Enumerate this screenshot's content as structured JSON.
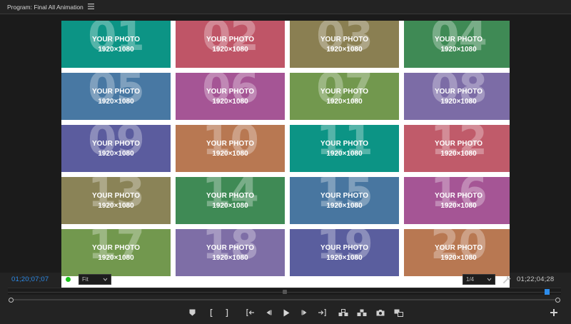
{
  "panel": {
    "title": "Program: Final All Animation",
    "menu_icon": "hamburger-icon"
  },
  "tiles": [
    {
      "num": "01",
      "label": "YOUR PHOTO",
      "res": "1920×1080",
      "color": "#0c9485"
    },
    {
      "num": "02",
      "label": "YOUR PHOTO",
      "res": "1920×1080",
      "color": "#bf5567"
    },
    {
      "num": "03",
      "label": "YOUR PHOTO",
      "res": "1920×1080",
      "color": "#8a7f52"
    },
    {
      "num": "04",
      "label": "YOUR PHOTO",
      "res": "1920×1080",
      "color": "#3f8a55"
    },
    {
      "num": "05",
      "label": "YOUR PHOTO",
      "res": "1920×1080",
      "color": "#4878a3"
    },
    {
      "num": "06",
      "label": "YOUR PHOTO",
      "res": "1920×1080",
      "color": "#a55595"
    },
    {
      "num": "07",
      "label": "YOUR PHOTO",
      "res": "1920×1080",
      "color": "#72984e"
    },
    {
      "num": "08",
      "label": "YOUR PHOTO",
      "res": "1920×1080",
      "color": "#7c6ca6"
    },
    {
      "num": "09",
      "label": "YOUR PHOTO",
      "res": "1920×1080",
      "color": "#5b5c9e"
    },
    {
      "num": "10",
      "label": "YOUR PHOTO",
      "res": "1920×1080",
      "color": "#b87852"
    },
    {
      "num": "11",
      "label": "YOUR PHOTO",
      "res": "1920×1080",
      "color": "#0c9485"
    },
    {
      "num": "12",
      "label": "YOUR PHOTO",
      "res": "1920×1080",
      "color": "#c05b6a"
    },
    {
      "num": "13",
      "label": "YOUR PHOTO",
      "res": "1920×1080",
      "color": "#8a8357"
    },
    {
      "num": "14",
      "label": "YOUR PHOTO",
      "res": "1920×1080",
      "color": "#3f8a55"
    },
    {
      "num": "15",
      "label": "YOUR PHOTO",
      "res": "1920×1080",
      "color": "#4876a0"
    },
    {
      "num": "16",
      "label": "YOUR PHOTO",
      "res": "1920×1080",
      "color": "#a55595"
    },
    {
      "num": "17",
      "label": "YOUR PHOTO",
      "res": "1920×1080",
      "color": "#72984e"
    },
    {
      "num": "18",
      "label": "YOUR PHOTO",
      "res": "1920×1080",
      "color": "#7e6ea6"
    },
    {
      "num": "19",
      "label": "YOUR PHOTO",
      "res": "1920×1080",
      "color": "#5a5e9e"
    },
    {
      "num": "20",
      "label": "YOUR PHOTO",
      "res": "1920×1080",
      "color": "#b87852"
    }
  ],
  "controls": {
    "timecode_current": "01;20;07;07",
    "timecode_duration": "01;22;04;28",
    "zoom_value": "Fit",
    "resolution_value": "1/4",
    "settings_icon": "wrench-icon",
    "accent": "#2d8ceb",
    "status_color": "#19c219"
  },
  "timeline": {
    "playhead_position": 0.977
  },
  "transport": {
    "buttons": [
      {
        "name": "add-marker-button",
        "icon": "marker-icon"
      },
      {
        "name": "mark-in-button",
        "icon": "mark-in-icon"
      },
      {
        "name": "mark-out-button",
        "icon": "mark-out-icon"
      },
      {
        "name": "go-to-in-button",
        "icon": "go-to-in-icon"
      },
      {
        "name": "step-back-button",
        "icon": "step-back-icon"
      },
      {
        "name": "play-button",
        "icon": "play-icon"
      },
      {
        "name": "step-forward-button",
        "icon": "step-forward-icon"
      },
      {
        "name": "go-to-out-button",
        "icon": "go-to-out-icon"
      },
      {
        "name": "lift-button",
        "icon": "lift-icon"
      },
      {
        "name": "extract-button",
        "icon": "extract-icon"
      },
      {
        "name": "export-frame-button",
        "icon": "camera-icon"
      },
      {
        "name": "comparison-view-button",
        "icon": "comparison-view-icon"
      }
    ],
    "add_icon": "plus-icon"
  }
}
